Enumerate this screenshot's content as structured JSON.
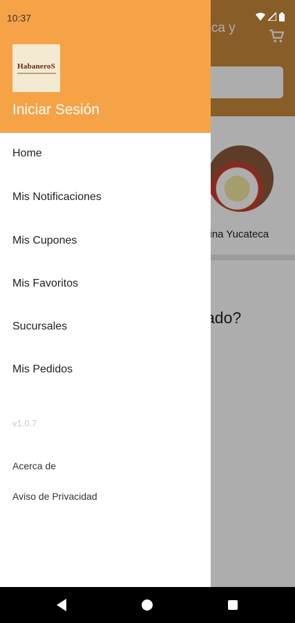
{
  "status_bar": {
    "time": "10:37"
  },
  "background": {
    "title_fragment": "teca y",
    "circle_label": "cina Yucateca",
    "question_fragment": "ado?"
  },
  "drawer": {
    "logo_text": "HabaneroS",
    "login_label": "Iniciar Sesión",
    "menu": [
      {
        "label": "Home"
      },
      {
        "label": "Mis Notificaciones"
      },
      {
        "label": "Mis Cupones"
      },
      {
        "label": "Mis Favoritos"
      },
      {
        "label": "Sucursales"
      },
      {
        "label": "Mis Pedidos"
      }
    ],
    "version": "v1.0.7",
    "links": [
      {
        "label": "Acerca de"
      },
      {
        "label": "Aviso de Privacidad"
      }
    ]
  },
  "colors": {
    "drawer_header": "#f6a347",
    "app_header": "#c98a3b"
  },
  "icons": {
    "cart": "cart-icon",
    "back": "back-icon",
    "home": "home-icon",
    "recent": "recent-apps-icon"
  }
}
